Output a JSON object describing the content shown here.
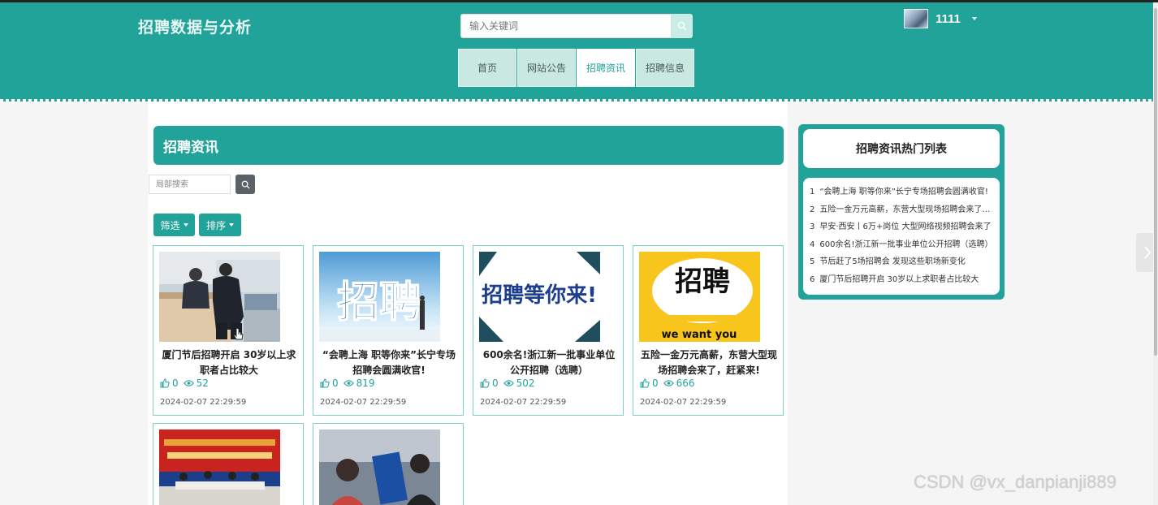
{
  "app": {
    "title": "招聘数据与分析"
  },
  "search": {
    "placeholder": "输入关键词"
  },
  "user": {
    "name": "1111"
  },
  "nav": [
    {
      "label": "首页",
      "active": false
    },
    {
      "label": "网站公告",
      "active": false
    },
    {
      "label": "招聘资讯",
      "active": true
    },
    {
      "label": "招聘信息",
      "active": false
    }
  ],
  "section": {
    "title": "招聘资讯",
    "local_search_placeholder": "局部搜索",
    "filter_label": "筛选",
    "sort_label": "排序"
  },
  "cards": [
    {
      "title": "厦门节后招聘开启 30岁以上求职者占比较大",
      "likes": "0",
      "views": "52",
      "date": "2024-02-07 22:29:59"
    },
    {
      "title": "“会聘上海 职等你来”长宁专场招聘会圆满收官!",
      "likes": "0",
      "views": "819",
      "date": "2024-02-07 22:29:59",
      "image_text": "招聘"
    },
    {
      "title": "600余名!浙江新一批事业单位公开招聘（选聘）",
      "likes": "0",
      "views": "502",
      "date": "2024-02-07 22:29:59",
      "image_text": "招聘等你来!"
    },
    {
      "title": "五险一金万元高薪，东营大型现场招聘会来了，赶紧来!",
      "likes": "0",
      "views": "666",
      "date": "2024-02-07 22:29:59",
      "image_text": "招聘",
      "image_text2": "we want you"
    },
    {
      "title": "",
      "likes": "",
      "views": "",
      "date": ""
    },
    {
      "title": "",
      "likes": "",
      "views": "",
      "date": ""
    }
  ],
  "hot_list": {
    "title": "招聘资讯热门列表",
    "items": [
      {
        "rank": "1",
        "text": "“会聘上海 职等你来”长宁专场招聘会圆满收官!"
      },
      {
        "rank": "2",
        "text": "五险一金万元高薪，东营大型现场招聘会来了，赶紧来!"
      },
      {
        "rank": "3",
        "text": "早安·西安丨6万+岗位 大型网络视频招聘会来了"
      },
      {
        "rank": "4",
        "text": "600余名!浙江新一批事业单位公开招聘（选聘）"
      },
      {
        "rank": "5",
        "text": "节后赶了5场招聘会 发现这些职场新变化"
      },
      {
        "rank": "6",
        "text": "厦门节后招聘开启 30岁以上求职者占比较大"
      }
    ]
  },
  "watermark": "CSDN @vx_danpianji889",
  "colors": {
    "primary": "#22a39a",
    "nav_bg": "#c8e8e1",
    "dark_btn": "#5b6167"
  }
}
